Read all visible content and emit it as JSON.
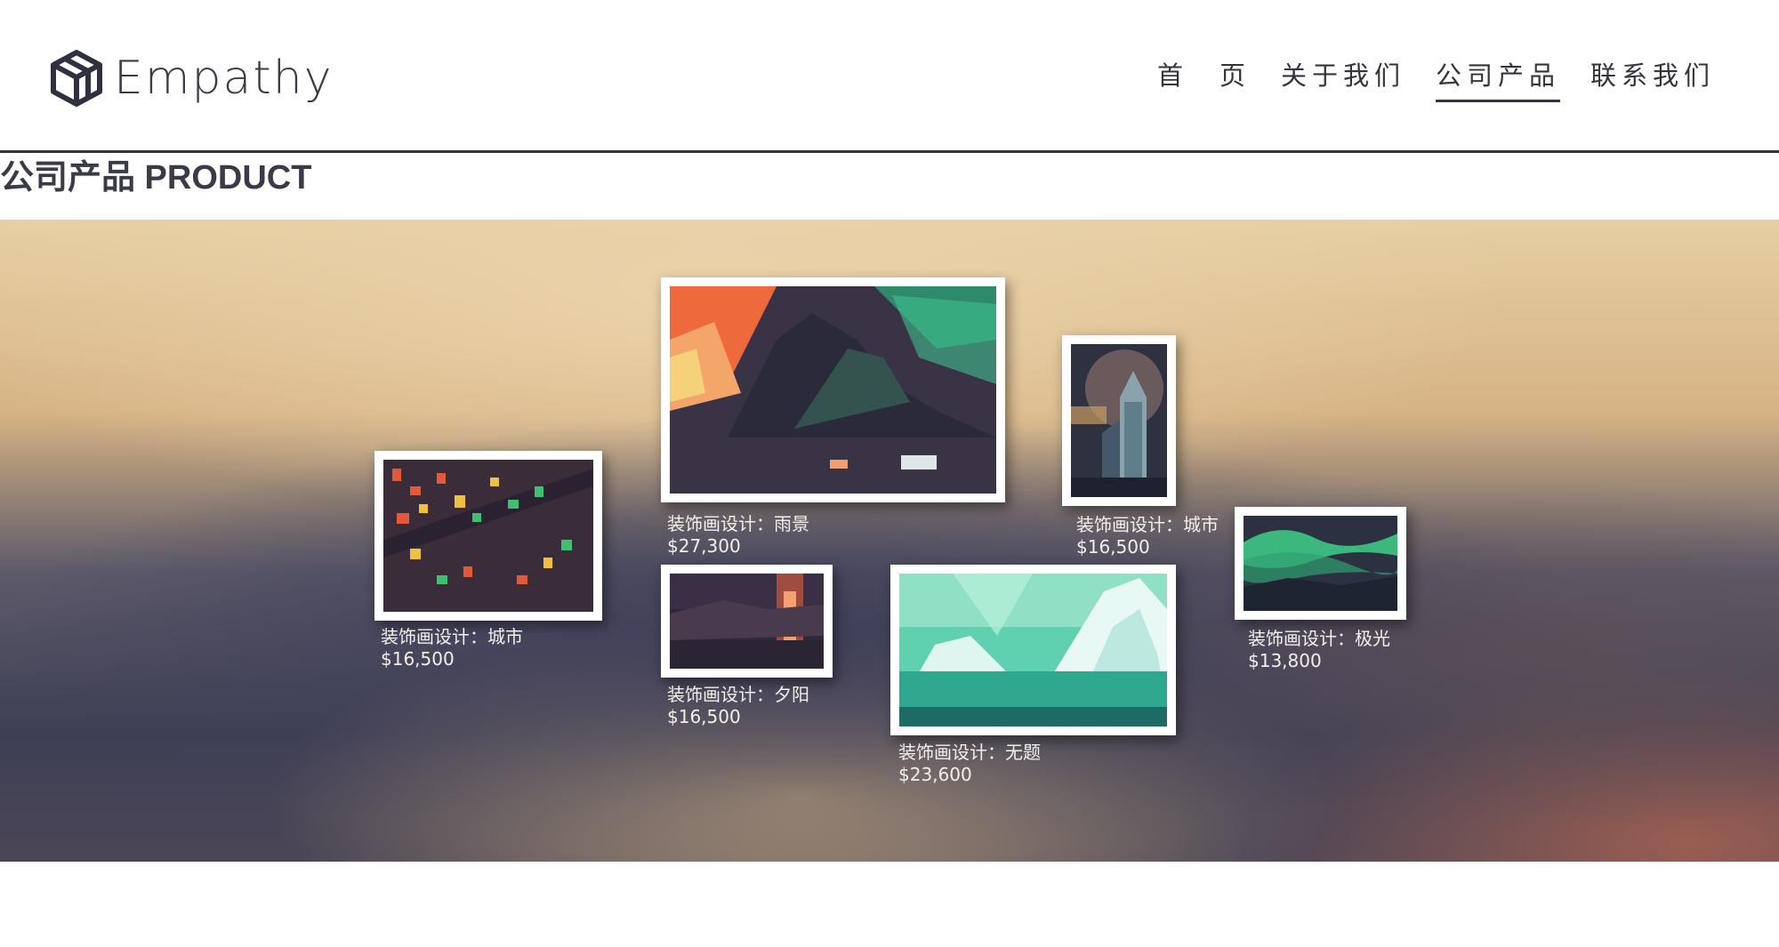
{
  "brand": {
    "name": "Empathy"
  },
  "nav": {
    "items": [
      {
        "label": "首　页",
        "active": false
      },
      {
        "label": "关于我们",
        "active": false
      },
      {
        "label": "公司产品",
        "active": true
      },
      {
        "label": "联系我们",
        "active": false
      }
    ]
  },
  "section": {
    "title": "公司产品 PRODUCT"
  },
  "products": [
    {
      "title": "装饰画设计：雨景",
      "price": "$27,300"
    },
    {
      "title": "装饰画设计：城市",
      "price": "$16,500"
    },
    {
      "title": "装饰画设计：城市",
      "price": "$16,500"
    },
    {
      "title": "装饰画设计：夕阳",
      "price": "$16,500"
    },
    {
      "title": "装饰画设计：无题",
      "price": "$23,600"
    },
    {
      "title": "装饰画设计：极光",
      "price": "$13,800"
    }
  ],
  "colors": {
    "text_dark": "#33343f",
    "frame": "#ffffff",
    "caption": "#f3efe9"
  }
}
